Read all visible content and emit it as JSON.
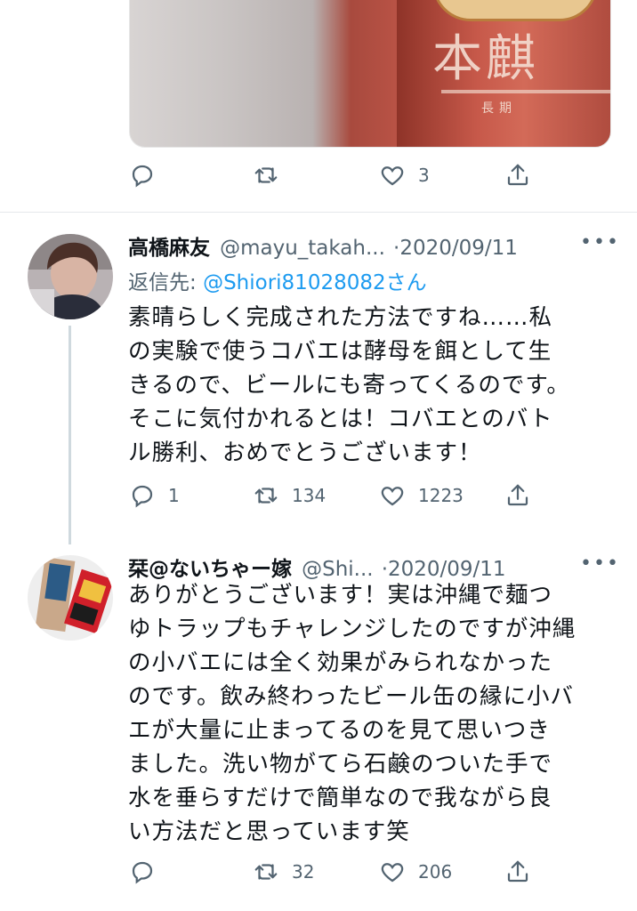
{
  "prev_tweet": {
    "image_alt_icon": "beer-can-photo",
    "image_text": "本麒",
    "actions": {
      "reply_count": "",
      "retweet_count": "",
      "like_count": "3"
    }
  },
  "tweet1": {
    "display_name": "高橋麻友",
    "handle": "@mayu_takah...",
    "separator": "·",
    "date": "2020/09/11",
    "reply_to_label": "返信先:",
    "reply_to_handle": "@Shiori81028082さん",
    "body_lines": [
      "素晴らしく完成された方法ですね……私",
      "の実験で使うコバエは酵母を餌として生",
      "きるので、ビールにも寄ってくるのです。",
      "そこに気付かれるとは！コバエとのバト",
      "ル勝利、おめでとうございます！"
    ],
    "actions": {
      "reply_count": "1",
      "retweet_count": "134",
      "like_count": "1223"
    }
  },
  "tweet2": {
    "display_name": "栞@ないちゃー嫁",
    "handle": "@Shi...",
    "separator": "·",
    "date": "2020/09/11",
    "body_lines": [
      "ありがとうございます！実は沖縄で麺つ",
      "ゆトラップもチャレンジしたのですが沖縄",
      "の小バエには全く効果がみられなかった",
      "のです。飲み終わったビール缶の縁に小バ",
      "エが大量に止まってるのを見て思いつき",
      "ました。洗い物がてら石鹸のついた手で",
      "水を垂らすだけで簡単なので我ながら良",
      "い方法だと思っています笑"
    ],
    "actions": {
      "reply_count": "",
      "retweet_count": "32",
      "like_count": "206"
    }
  },
  "icons": {
    "reply": "reply-icon",
    "retweet": "retweet-icon",
    "like": "heart-icon",
    "share": "share-icon",
    "more": "more-icon"
  },
  "colors": {
    "link": "#1d9bf0",
    "secondary": "#536471",
    "text": "#0f1419",
    "divider": "#e5e8eb"
  }
}
